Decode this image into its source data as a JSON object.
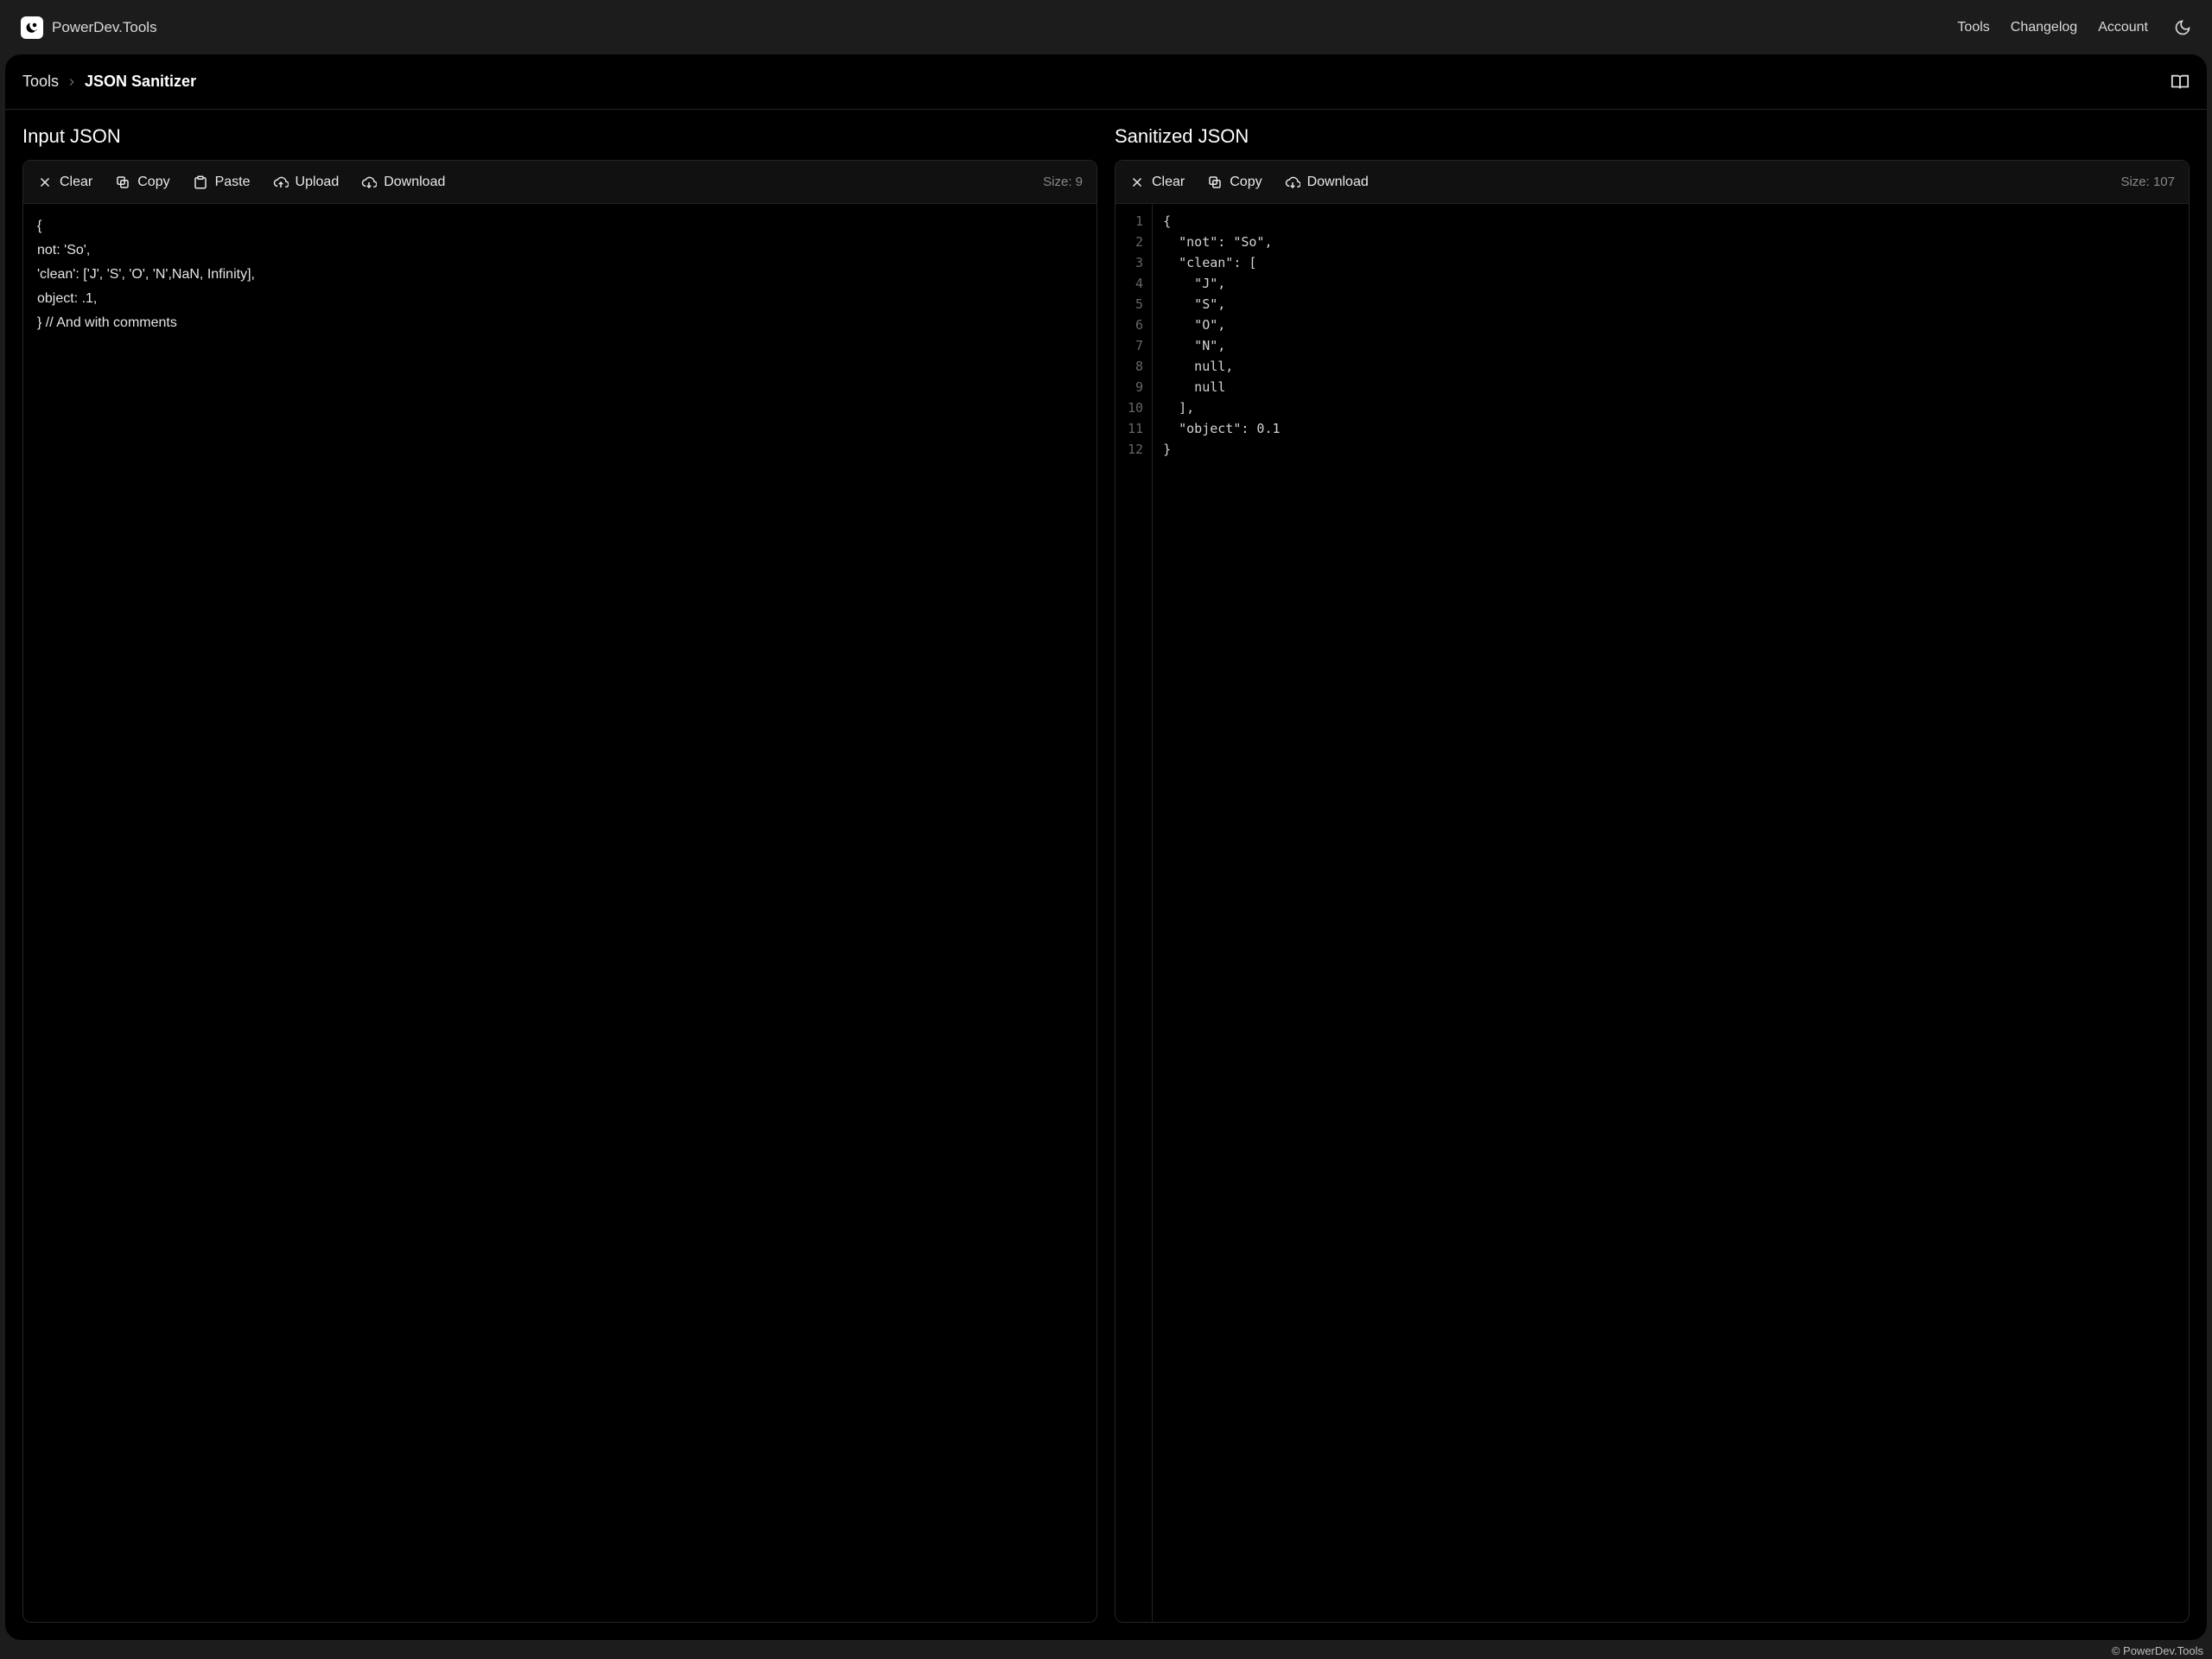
{
  "brand": {
    "name": "PowerDev.Tools"
  },
  "nav": {
    "tools": "Tools",
    "changelog": "Changelog",
    "account": "Account"
  },
  "breadcrumb": {
    "root": "Tools",
    "current": "JSON Sanitizer"
  },
  "panes": {
    "input": {
      "title": "Input JSON",
      "toolbar": {
        "clear": "Clear",
        "copy": "Copy",
        "paste": "Paste",
        "upload": "Upload",
        "download": "Download",
        "size": "Size: 9"
      },
      "content": "{\nnot: 'So',\n'clean': ['J', 'S', 'O', 'N',NaN, Infinity],\nobject: .1,\n} // And with comments"
    },
    "output": {
      "title": "Sanitized JSON",
      "toolbar": {
        "clear": "Clear",
        "copy": "Copy",
        "download": "Download",
        "size": "Size: 107"
      },
      "lines": [
        "{",
        "  \"not\": \"So\",",
        "  \"clean\": [",
        "    \"J\",",
        "    \"S\",",
        "    \"O\",",
        "    \"N\",",
        "    null,",
        "    null",
        "  ],",
        "  \"object\": 0.1",
        "}"
      ]
    }
  },
  "footer": {
    "copyright": "© PowerDev.Tools"
  }
}
